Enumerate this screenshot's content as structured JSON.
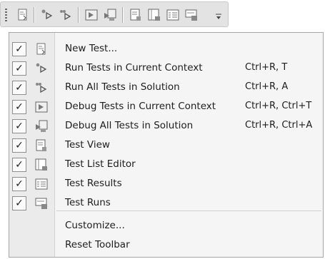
{
  "toolbar": {
    "buttons": [
      {
        "icon": "new-test-icon"
      },
      {
        "icon": "run-tests-in-context-icon"
      },
      {
        "icon": "run-all-tests-icon"
      },
      {
        "icon": "debug-tests-in-context-icon"
      },
      {
        "icon": "debug-all-tests-icon"
      },
      {
        "icon": "test-view-icon"
      },
      {
        "icon": "test-list-editor-icon"
      },
      {
        "icon": "test-results-icon"
      },
      {
        "icon": "test-runs-icon"
      }
    ],
    "overflow_icon": "chevron-down-icon"
  },
  "menu": {
    "items": [
      {
        "label": "New Test...",
        "shortcut": "",
        "checked": true,
        "icon": "new-test-icon"
      },
      {
        "label": "Run Tests in Current Context",
        "shortcut": "Ctrl+R, T",
        "checked": true,
        "icon": "run-tests-in-context-icon"
      },
      {
        "label": "Run All Tests in Solution",
        "shortcut": "Ctrl+R, A",
        "checked": true,
        "icon": "run-all-tests-icon"
      },
      {
        "label": "Debug Tests in Current Context",
        "shortcut": "Ctrl+R, Ctrl+T",
        "checked": true,
        "icon": "debug-tests-in-context-icon"
      },
      {
        "label": "Debug All Tests in Solution",
        "shortcut": "Ctrl+R, Ctrl+A",
        "checked": true,
        "icon": "debug-all-tests-icon"
      },
      {
        "label": "Test View",
        "shortcut": "",
        "checked": true,
        "icon": "test-view-icon"
      },
      {
        "label": "Test List Editor",
        "shortcut": "",
        "checked": true,
        "icon": "test-list-editor-icon"
      },
      {
        "label": "Test Results",
        "shortcut": "",
        "checked": true,
        "icon": "test-results-icon"
      },
      {
        "label": "Test Runs",
        "shortcut": "",
        "checked": true,
        "icon": "test-runs-icon"
      }
    ],
    "footer_items": [
      {
        "label": "Customize..."
      },
      {
        "label": "Reset Toolbar"
      }
    ],
    "check_glyph": "✓"
  }
}
